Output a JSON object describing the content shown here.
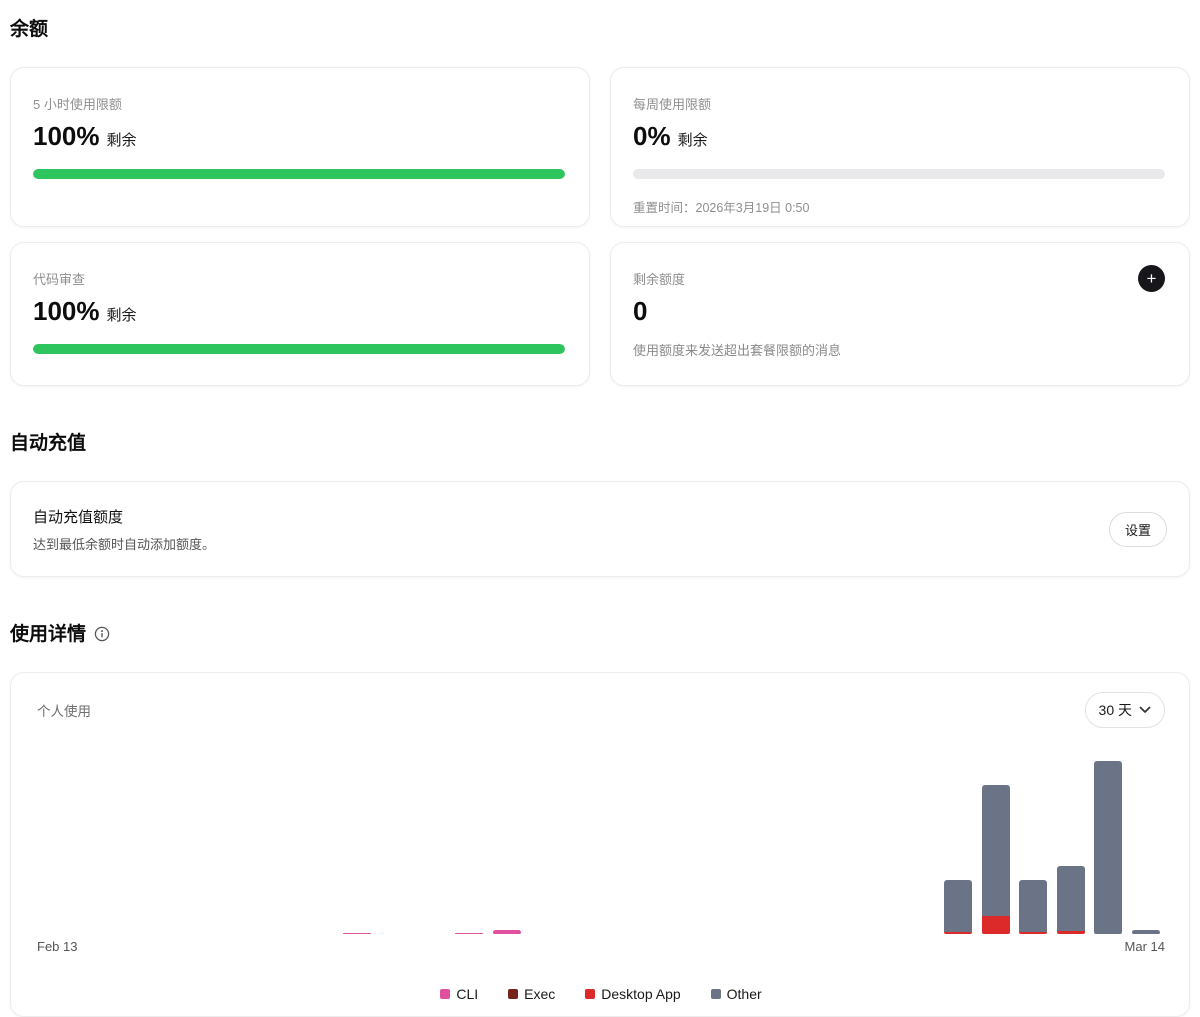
{
  "sections": {
    "balance": {
      "heading": "余额",
      "cards": {
        "five_hour": {
          "label": "5 小时使用限额",
          "value": "100%",
          "suffix": "剩余",
          "progress": 100
        },
        "weekly": {
          "label": "每周使用限额",
          "value": "0%",
          "suffix": "剩余",
          "progress": 0,
          "reset_note": "重置时间：2026年3月19日 0:50"
        },
        "code_review": {
          "label": "代码审查",
          "value": "100%",
          "suffix": "剩余",
          "progress": 100
        },
        "extra_credits": {
          "label": "剩余额度",
          "value": "0",
          "description": "使用额度来发送超出套餐限额的消息",
          "add_button": "+"
        }
      }
    },
    "auto_recharge": {
      "heading": "自动充值",
      "card": {
        "title": "自动充值额度",
        "description": "达到最低余额时自动添加额度。",
        "button_label": "设置"
      }
    },
    "usage": {
      "heading": "使用详情",
      "card_title": "个人使用",
      "range_selector_label": "30 天"
    }
  },
  "colors": {
    "progress_green": "#2ec55e",
    "progress_track": "#e9e9eb",
    "accent_black": "#17171b"
  },
  "chart_data": {
    "type": "bar",
    "stacked": true,
    "num_slots": 30,
    "x_first_label": "Feb 13",
    "x_last_label": "Mar 14",
    "y_axis_visible": false,
    "y_unit": "relative height (tallest bar = 173)",
    "ylim": [
      0,
      175
    ],
    "legend_position": "bottom-center",
    "legend": [
      {
        "label": "CLI",
        "color": "#e0509f"
      },
      {
        "label": "Exec",
        "color": "#772418"
      },
      {
        "label": "Desktop App",
        "color": "#dc2a2a"
      },
      {
        "label": "Other",
        "color": "#6b7486"
      }
    ],
    "bars": [
      {
        "slot": 8,
        "date_hint": "Feb 21",
        "segments": [
          {
            "series": "CLI",
            "value": 1
          }
        ]
      },
      {
        "slot": 11,
        "date_hint": "Feb 24",
        "segments": [
          {
            "series": "CLI",
            "value": 1
          }
        ]
      },
      {
        "slot": 12,
        "date_hint": "Feb 25",
        "segments": [
          {
            "series": "CLI",
            "value": 4
          }
        ]
      },
      {
        "slot": 24,
        "date_hint": "Mar 9",
        "segments": [
          {
            "series": "Desktop App",
            "value": 2
          },
          {
            "series": "Other",
            "value": 52
          }
        ]
      },
      {
        "slot": 25,
        "date_hint": "Mar 10",
        "segments": [
          {
            "series": "Desktop App",
            "value": 18
          },
          {
            "series": "Other",
            "value": 131
          }
        ]
      },
      {
        "slot": 26,
        "date_hint": "Mar 11",
        "segments": [
          {
            "series": "Desktop App",
            "value": 2
          },
          {
            "series": "Other",
            "value": 52
          }
        ]
      },
      {
        "slot": 27,
        "date_hint": "Mar 12",
        "segments": [
          {
            "series": "Desktop App",
            "value": 3
          },
          {
            "series": "Other",
            "value": 65
          }
        ]
      },
      {
        "slot": 28,
        "date_hint": "Mar 13",
        "segments": [
          {
            "series": "Other",
            "value": 173
          }
        ]
      },
      {
        "slot": 29,
        "date_hint": "Mar 14",
        "segments": [
          {
            "series": "Other",
            "value": 4
          }
        ]
      }
    ]
  }
}
